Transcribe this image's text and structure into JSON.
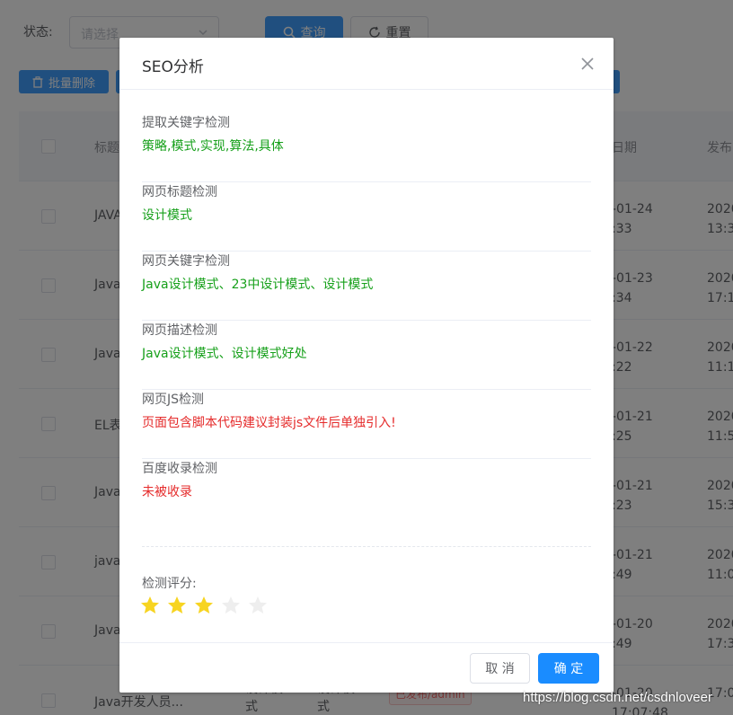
{
  "filter": {
    "status_label": "状态:",
    "status_placeholder": "请选择",
    "search_label": "查询",
    "reset_label": "重置",
    "batch_delete_label": "批量删除"
  },
  "table": {
    "header_title": "标题",
    "header_date": "日期",
    "header_pub": "发布",
    "rows": [
      {
        "title": "JAVA",
        "date": "-01-24\n:33",
        "pub": "2020\n13:3"
      },
      {
        "title": "Java",
        "date": "-01-23\n:34",
        "pub": "2020\n17:1"
      },
      {
        "title": "Java",
        "date": "-01-22\n:22",
        "pub": "2020\n11:1"
      },
      {
        "title": "EL表",
        "date": "-01-21\n:25",
        "pub": "2020\n11:5"
      },
      {
        "title": "Java",
        "date": "-01-21\n:23",
        "pub": "2020\n15:3"
      },
      {
        "title": "java",
        "date": "-01-21\n:49",
        "pub": "2020\n11:0"
      },
      {
        "title": "Java",
        "date": "-01-20\n:49",
        "pub": "2020\n17:3"
      },
      {
        "title": "Java开发人员...",
        "col2": "设计模\n式",
        "col3": "设计模\n式",
        "tag": "已发布/admin",
        "date": "-01-20\n17:07:48",
        "pub": "17:0"
      }
    ]
  },
  "dialog": {
    "title": "SEO分析",
    "items": [
      {
        "label": "提取关键字检测",
        "value": "策略,模式,实现,算法,具体",
        "status": "ok"
      },
      {
        "label": "网页标题检测",
        "value": "设计模式",
        "status": "ok"
      },
      {
        "label": "网页关键字检测",
        "value": "Java设计模式、23中设计模式、设计模式",
        "status": "ok"
      },
      {
        "label": "网页描述检测",
        "value": "Java设计模式、设计模式好处",
        "status": "ok"
      },
      {
        "label": "网页JS检测",
        "value": "页面包含脚本代码建议封装js文件后单独引入!",
        "status": "warn"
      },
      {
        "label": "百度收录检测",
        "value": "未被收录",
        "status": "warn"
      }
    ],
    "score_label": "检测评分:",
    "score": {
      "value": 3,
      "max": 5
    },
    "cancel_label": "取 消",
    "ok_label": "确 定"
  },
  "colors": {
    "ok": "#16a01a",
    "warn": "#e52b2b",
    "star_on": "#f7d421",
    "star_off": "#eeeeee",
    "primary": "#409eff"
  },
  "watermark": "https://blog.csdn.net/csdnloveer"
}
